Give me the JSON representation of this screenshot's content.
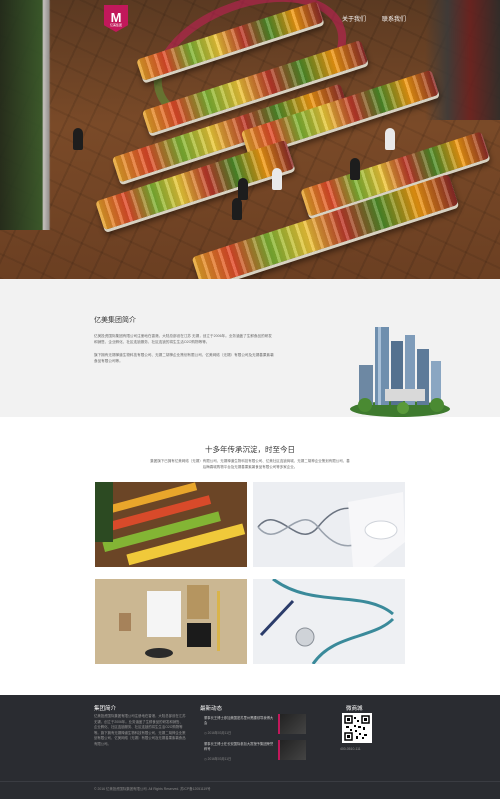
{
  "header": {
    "logo_text": "M",
    "logo_sub": "亿美集团",
    "nav": [
      "关于我们",
      "联系我们"
    ]
  },
  "about": {
    "title": "亿美集团简介",
    "paragraph1": "亿美投资国际集团有限公司注册地在香港，大陆总部设在江苏 无锡，创立于2006年。业务涵盖了生鲜食品的研发和销售、企业孵化、社区连锁服务、社区连锁的将生生活O2O购物等等。",
    "paragraph2": "旗下拥有无锡禅道生物科技有限公司、无锡二胡神企业策划有限公司、亿美网络（无锡）有限公司及无锡善果紫薯食品有限公司等。"
  },
  "tradition": {
    "title": "十多年传承沉淀，时至今日",
    "desc": "集团旗下已拥有亿美网络（无锡）有限公司、无锡禅道生物科技有限公司、亿美社区连锁商城、无锡二胡神企业策划有限公司、善后梅喜城购物平台及无锡善果紫薯食品有限公司等多家企业。"
  },
  "tiles": [
    {
      "name": "supermarket-image"
    },
    {
      "name": "dna-research-image"
    },
    {
      "name": "branding-stationery-image"
    },
    {
      "name": "stethoscope-image"
    }
  ],
  "footer": {
    "about_title": "集团简介",
    "about_text": "亿美投资国际集团有限公司注册地在香港，大陆总部设在江苏 无锡，创立于2006年。业务涵盖了生鲜食品的研发和销售、企业孵化、社区连锁服务、社区连锁的将生生活O2O购物等等。旗下拥有无锡禅道生物科技有限公司、无锡二胡神企业策划有限公司、亿美网络（无锡）有限公司及无锡善果紫薯食品有限公司。",
    "news_title": "最新动态",
    "news": [
      {
        "title": "董事长王博士参加美国密苏里州黑腰领导我博大会",
        "date": "2016年03月11日"
      },
      {
        "title": "董事长王博士在长安国际参加大赛授予集团荣誉称号",
        "date": "2016年03月11日"
      }
    ],
    "mall_title": "微商城",
    "phone": "400-0510-111",
    "copyright": "© 2016 亿美投资国际集团有限公司. All Rights Reserved. 苏ICP备12051119号"
  },
  "colors": {
    "brand": "#c2185b",
    "about_bg": "#f2f2f2",
    "footer_bg": "#2a2c31"
  }
}
